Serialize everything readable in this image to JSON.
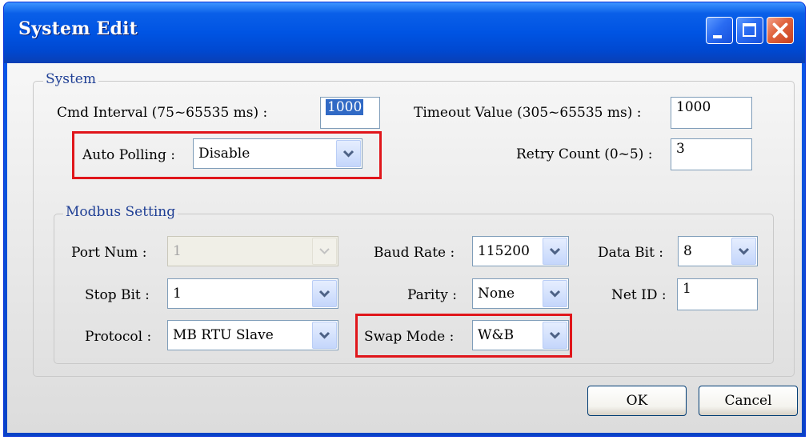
{
  "window": {
    "title": "System Edit",
    "icons": {
      "minimize": "minimize-icon",
      "maximize": "maximize-icon",
      "close": "close-icon"
    }
  },
  "system": {
    "group_title": "System",
    "cmd_interval": {
      "label": "Cmd Interval (75~65535 ms) :",
      "value": "1000"
    },
    "timeout": {
      "label": "Timeout Value (305~65535 ms) :",
      "value": "1000"
    },
    "auto_polling": {
      "label": "Auto Polling :",
      "value": "Disable"
    },
    "retry": {
      "label": "Retry Count (0~5) :",
      "value": "3"
    }
  },
  "modbus": {
    "group_title": "Modbus Setting",
    "port_num": {
      "label": "Port Num :",
      "value": "1"
    },
    "baud_rate": {
      "label": "Baud Rate :",
      "value": "115200"
    },
    "data_bit": {
      "label": "Data Bit :",
      "value": "8"
    },
    "stop_bit": {
      "label": "Stop Bit :",
      "value": "1"
    },
    "parity": {
      "label": "Parity :",
      "value": "None"
    },
    "net_id": {
      "label": "Net ID :",
      "value": "1"
    },
    "protocol": {
      "label": "Protocol :",
      "value": "MB RTU Slave"
    },
    "swap_mode": {
      "label": "Swap Mode :",
      "value": "W&B"
    }
  },
  "buttons": {
    "ok": "OK",
    "cancel": "Cancel"
  },
  "colors": {
    "title_bar": "#0054e3",
    "highlight": "#e0161b",
    "group_title": "#1f3f95",
    "selection": "#316ac5"
  }
}
